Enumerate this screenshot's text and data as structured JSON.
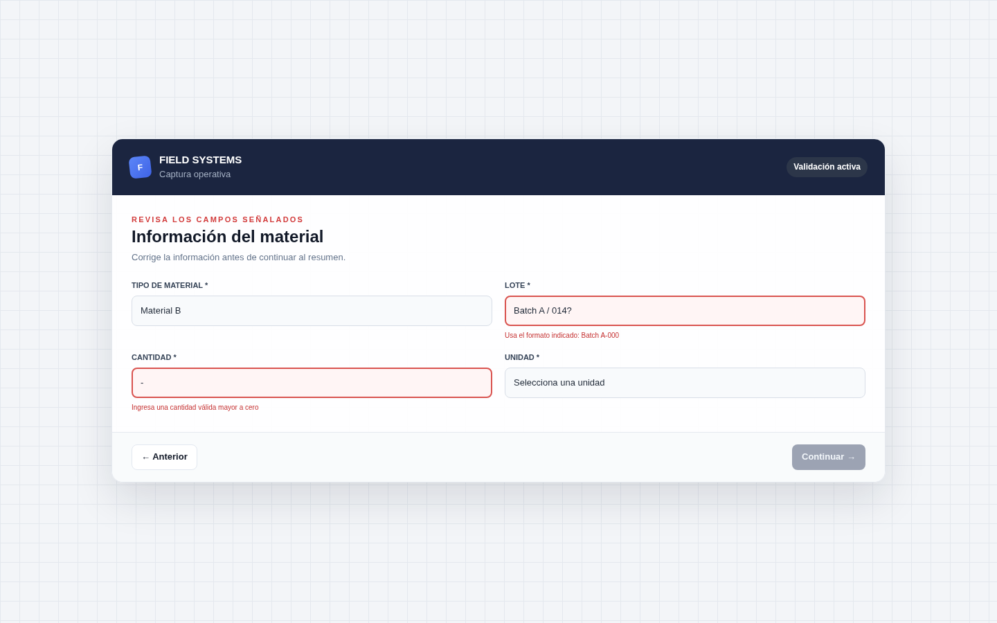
{
  "header": {
    "logo_letter": "F",
    "title": "FIELD SYSTEMS",
    "subtitle": "Captura operativa",
    "badge": "Validación activa"
  },
  "form": {
    "eyebrow": "REVISA LOS CAMPOS SEÑALADOS",
    "title": "Información del material",
    "description": "Corrige la información antes de continuar al resumen.",
    "fields": [
      {
        "label": "TIPO DE MATERIAL *",
        "value": "Material B",
        "invalid": false
      },
      {
        "label": "LOTE *",
        "value": "Batch A / 014?",
        "invalid": true,
        "error": "Usa el formato indicado: Batch A-000"
      },
      {
        "label": "CANTIDAD *",
        "value": "-",
        "invalid": true,
        "error": "Ingresa una cantidad válida mayor a cero"
      },
      {
        "label": "UNIDAD *",
        "value": "Selecciona una unidad",
        "invalid": false
      }
    ]
  },
  "footer": {
    "back_button": {
      "label": "← Anterior"
    },
    "next_button": {
      "label": "Continuar →",
      "disabled": true
    }
  }
}
